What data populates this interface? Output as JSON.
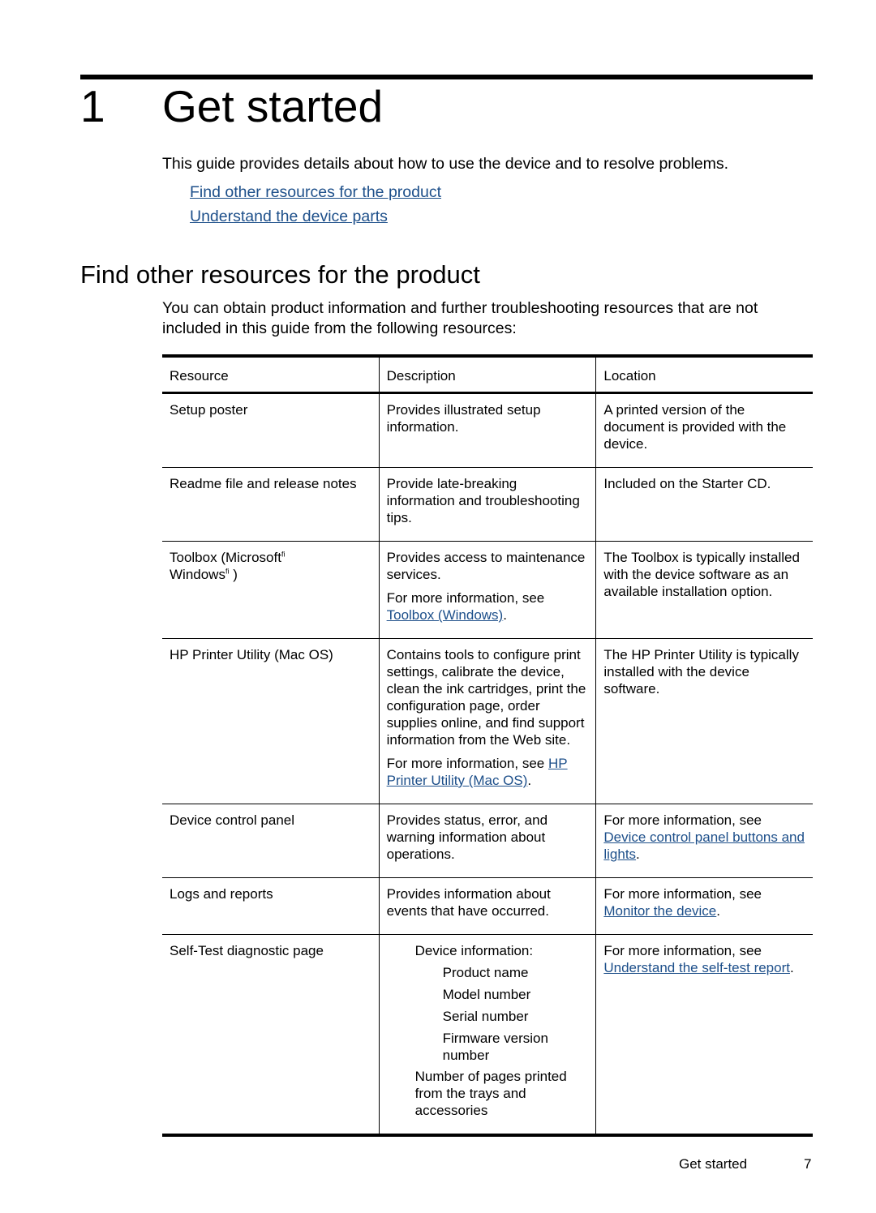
{
  "chapter": {
    "number": "1",
    "title": "Get started"
  },
  "intro": "This guide provides details about how to use the device and to resolve problems.",
  "toc": [
    {
      "label": "Find other resources for the product"
    },
    {
      "label": "Understand the device parts"
    }
  ],
  "section": {
    "heading": "Find other resources for the product",
    "paragraph": "You can obtain product information and further troubleshooting resources that are not included in this guide from the following resources:"
  },
  "table": {
    "headers": [
      "Resource",
      "Description",
      "Location"
    ],
    "rows": [
      {
        "resource": "Setup poster",
        "description": "Provides illustrated setup information.",
        "location": "A printed version of the document is provided with the device."
      },
      {
        "resource": "Readme file and release notes",
        "description": "Provide late-breaking information and troubleshooting tips.",
        "location": "Included on the Starter CD."
      },
      {
        "resource_part1": "Toolbox (Microsoft",
        "resource_sup1": "fi",
        "resource_part2": "Windows",
        "resource_sup2": "fi",
        "resource_part3": " )",
        "description": "Provides access to maintenance services.",
        "description_more": "For more information, see ",
        "description_link": "Toolbox (Windows)",
        "description_end": ".",
        "location": "The Toolbox is typically installed with the device software as an available installation option."
      },
      {
        "resource": "HP Printer Utility (Mac OS)",
        "description": "Contains tools to configure print settings, calibrate the device, clean the ink cartridges, print the configuration page, order supplies online, and find support information from the Web site.",
        "description_more": "For more information, see ",
        "description_link": "HP Printer Utility (Mac OS)",
        "description_end": ".",
        "location": "The HP Printer Utility is typically installed with the device software."
      },
      {
        "resource": "Device control panel",
        "description": "Provides status, error, and warning information about operations.",
        "location_text": "For more information, see ",
        "location_link": "Device control panel buttons and lights",
        "location_end": "."
      },
      {
        "resource": "Logs and reports",
        "description": "Provides information about events that have occurred.",
        "location_text": "For more information, see ",
        "location_link": "Monitor the device",
        "location_end": "."
      },
      {
        "resource": "Self-Test diagnostic page",
        "description_list": {
          "heading": "Device information:",
          "items": [
            "Product name",
            "Model number",
            "Serial number",
            "Firmware version number"
          ],
          "extra": "Number of pages printed from the trays and accessories"
        },
        "location_text": "For more information, see ",
        "location_link": "Understand the self-test report",
        "location_end": "."
      }
    ]
  },
  "footer": {
    "section": "Get started",
    "page": "7"
  }
}
